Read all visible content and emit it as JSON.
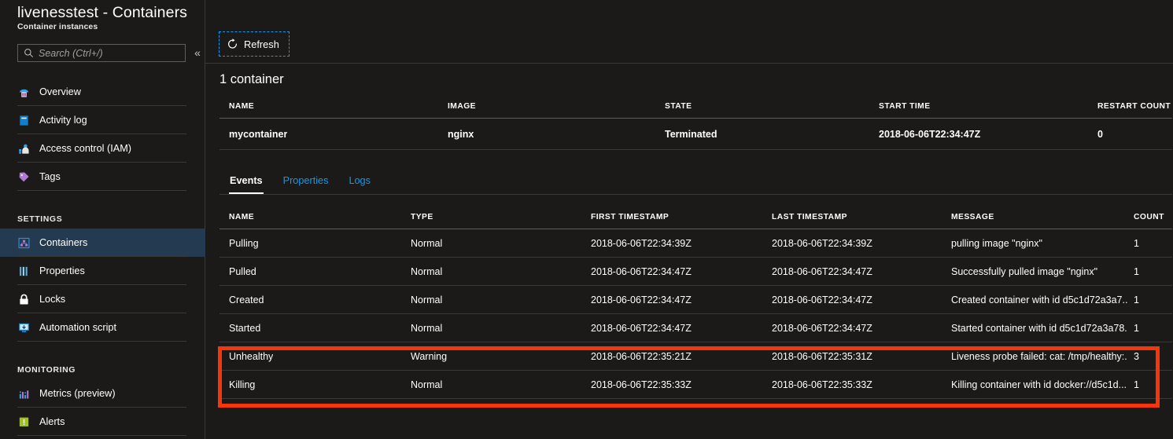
{
  "blade": {
    "title": "livenesstest - Containers",
    "subtitle": "Container instances"
  },
  "search": {
    "placeholder": "Search (Ctrl+/)",
    "value": "",
    "icon": "search-icon"
  },
  "collapse": {
    "glyph": "«",
    "name": "collapse-blade-icon"
  },
  "sidebar": {
    "items": [
      {
        "label": "Overview",
        "icon": "overview-icon",
        "type": "item",
        "selected": false
      },
      {
        "label": "Activity log",
        "icon": "activity-log-icon",
        "type": "item",
        "selected": false
      },
      {
        "label": "Access control (IAM)",
        "icon": "access-control-icon",
        "type": "item",
        "selected": false
      },
      {
        "label": "Tags",
        "icon": "tags-icon",
        "type": "item",
        "selected": false
      },
      {
        "label": "SETTINGS",
        "icon": "",
        "type": "section",
        "selected": false
      },
      {
        "label": "Containers",
        "icon": "containers-icon",
        "type": "item",
        "selected": true
      },
      {
        "label": "Properties",
        "icon": "properties-icon",
        "type": "item",
        "selected": false
      },
      {
        "label": "Locks",
        "icon": "lock-icon",
        "type": "item",
        "selected": false
      },
      {
        "label": "Automation script",
        "icon": "automation-icon",
        "type": "item",
        "selected": false
      },
      {
        "label": "MONITORING",
        "icon": "",
        "type": "section",
        "selected": false
      },
      {
        "label": "Metrics (preview)",
        "icon": "metrics-icon",
        "type": "item",
        "selected": false
      },
      {
        "label": "Alerts",
        "icon": "alerts-icon",
        "type": "item",
        "selected": false
      }
    ]
  },
  "toolbar": {
    "refresh_label": "Refresh",
    "refresh_icon": "refresh-icon"
  },
  "containers_section": {
    "heading": "1 container",
    "columns": [
      "NAME",
      "IMAGE",
      "STATE",
      "START TIME",
      "RESTART COUNT"
    ],
    "rows": [
      {
        "name": "mycontainer",
        "image": "nginx",
        "state": "Terminated",
        "start_time": "2018-06-06T22:34:47Z",
        "restart_count": "0"
      }
    ]
  },
  "tabs": [
    {
      "label": "Events",
      "active": true
    },
    {
      "label": "Properties",
      "active": false
    },
    {
      "label": "Logs",
      "active": false
    }
  ],
  "events_section": {
    "columns": [
      "NAME",
      "TYPE",
      "FIRST TIMESTAMP",
      "LAST TIMESTAMP",
      "MESSAGE",
      "COUNT"
    ],
    "rows": [
      {
        "name": "Pulling",
        "type": "Normal",
        "first_timestamp": "2018-06-06T22:34:39Z",
        "last_timestamp": "2018-06-06T22:34:39Z",
        "message": "pulling image \"nginx\"",
        "count": "1",
        "highlighted": false
      },
      {
        "name": "Pulled",
        "type": "Normal",
        "first_timestamp": "2018-06-06T22:34:47Z",
        "last_timestamp": "2018-06-06T22:34:47Z",
        "message": "Successfully pulled image \"nginx\"",
        "count": "1",
        "highlighted": false
      },
      {
        "name": "Created",
        "type": "Normal",
        "first_timestamp": "2018-06-06T22:34:47Z",
        "last_timestamp": "2018-06-06T22:34:47Z",
        "message": "Created container with id d5c1d72a3a7...",
        "count": "1",
        "highlighted": false
      },
      {
        "name": "Started",
        "type": "Normal",
        "first_timestamp": "2018-06-06T22:34:47Z",
        "last_timestamp": "2018-06-06T22:34:47Z",
        "message": "Started container with id d5c1d72a3a78...",
        "count": "1",
        "highlighted": false
      },
      {
        "name": "Unhealthy",
        "type": "Warning",
        "first_timestamp": "2018-06-06T22:35:21Z",
        "last_timestamp": "2018-06-06T22:35:31Z",
        "message": "Liveness probe failed: cat: /tmp/healthy:...",
        "count": "3",
        "highlighted": true
      },
      {
        "name": "Killing",
        "type": "Normal",
        "first_timestamp": "2018-06-06T22:35:33Z",
        "last_timestamp": "2018-06-06T22:35:33Z",
        "message": "Killing container with id docker://d5c1d...",
        "count": "1",
        "highlighted": true
      }
    ]
  },
  "annotation": {
    "highlight_color": "#f5360c",
    "name": "red-highlight-box"
  },
  "colors": {
    "background": "#1b1a19",
    "selected_nav": "#243a51",
    "link": "#0f9bf0",
    "divider": "#3b3a39"
  }
}
